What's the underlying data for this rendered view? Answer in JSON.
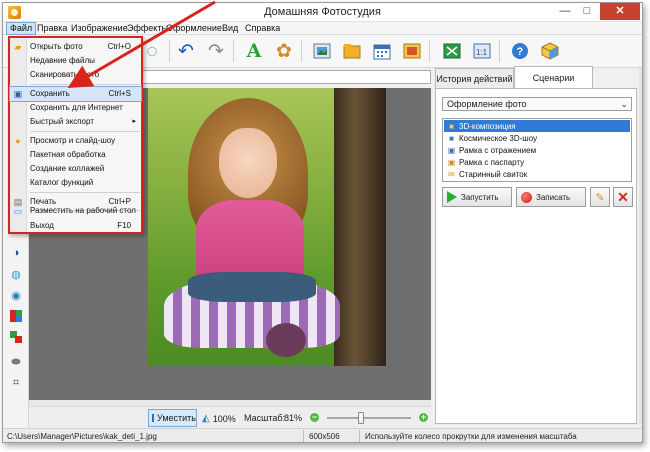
{
  "window": {
    "title": "Домашняя Фотостудия",
    "minimize": "—",
    "maximize": "□",
    "close": "✕"
  },
  "menubar": {
    "items": [
      "Файл",
      "Правка",
      "Изображение",
      "Эффекты",
      "Оформление",
      "Вид",
      "Справка"
    ],
    "active": "Файл"
  },
  "file_menu": {
    "items": [
      {
        "label": "Открыть фото",
        "shortcut": "Ctrl+O",
        "icon": "open-folder-icon"
      },
      {
        "label": "Недавние файлы",
        "shortcut": "",
        "icon": ""
      },
      {
        "label": "Сканировать фото",
        "shortcut": "",
        "icon": ""
      },
      {
        "label": "Сохранить",
        "shortcut": "Ctrl+S",
        "icon": "save-disk-icon",
        "highlighted": true
      },
      {
        "label": "Сохранить для Интернет",
        "shortcut": "",
        "icon": ""
      },
      {
        "label": "Быстрый экспорт",
        "shortcut": "",
        "icon": "",
        "submenu": true
      },
      {
        "label": "Просмотр и слайд-шоу",
        "shortcut": "",
        "icon": "slideshow-icon"
      },
      {
        "label": "Пакетная обработка",
        "shortcut": "",
        "icon": ""
      },
      {
        "label": "Создание коллажей",
        "shortcut": "",
        "icon": ""
      },
      {
        "label": "Каталог функций",
        "shortcut": "",
        "icon": ""
      },
      {
        "label": "Печать",
        "shortcut": "Ctrl+P",
        "icon": "printer-icon"
      },
      {
        "label": "Разместить на рабочий стол",
        "shortcut": "",
        "icon": "desktop-icon"
      },
      {
        "label": "Выход",
        "shortcut": "F10",
        "icon": ""
      }
    ],
    "submenu_arrow": "▸"
  },
  "right_panel": {
    "tabs": [
      "История действий",
      "Сценарии"
    ],
    "active_tab": "Сценарии",
    "dropdown_value": "Оформление фото",
    "dropdown_arrow": "⌄",
    "scenarios": [
      {
        "label": "3D-композиция",
        "selected": true
      },
      {
        "label": "Космическое 3D-шоу",
        "selected": false
      },
      {
        "label": "Рамка с отражением",
        "selected": false
      },
      {
        "label": "Рамка с паспарту",
        "selected": false
      },
      {
        "label": "Старинный свиток",
        "selected": false
      }
    ],
    "run_label": "Запустить",
    "record_label": "Записать",
    "delete_symbol": "✕",
    "wand_symbol": "✎"
  },
  "zoombar": {
    "fit_label": "Уместить",
    "z100_label": "100%",
    "scale_label": "Масштаб:",
    "scale_value": "81%",
    "minus": "−",
    "plus": "+"
  },
  "status": {
    "path": "C:\\Users\\Manager\\Pictures\\kak_deti_1.jpg",
    "dimensions": "600x506",
    "hint": "Используйте колесо прокрутки для изменения масштаба"
  },
  "colors": {
    "accent": "#2f7bd5",
    "annotation_red": "#d9231c",
    "close_button": "#c7412f"
  }
}
